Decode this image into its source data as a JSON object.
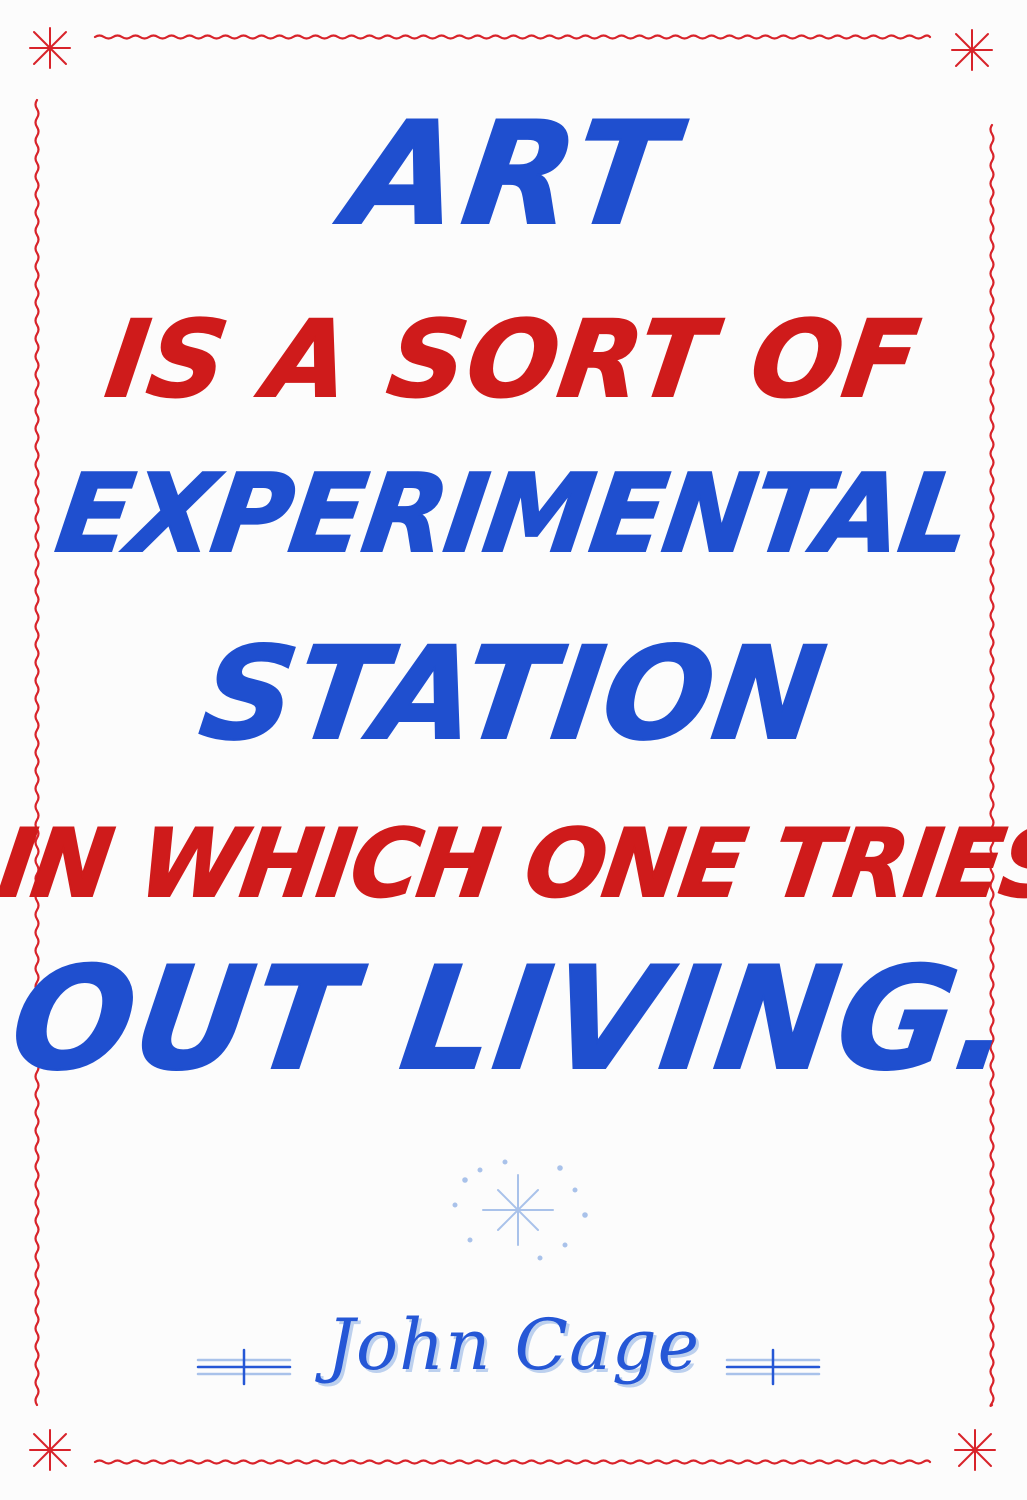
{
  "poster": {
    "lines": [
      {
        "text": "ART",
        "color": "#1f4fcf"
      },
      {
        "text": "IS A SORT OF",
        "color": "#cf1b1b"
      },
      {
        "text": "EXPERIMENTAL",
        "color": "#1f4fcf"
      },
      {
        "text": "STATION",
        "color": "#1f4fcf"
      },
      {
        "text": "IN WHICH ONE TRIES",
        "color": "#cf1b1b"
      },
      {
        "text": "OUT LIVING.",
        "color": "#1f4fcf"
      }
    ],
    "author": "John Cage"
  },
  "colors": {
    "blue": "#1f4fcf",
    "red": "#cf1b1b",
    "light_blue": "#bcd0ee",
    "paper": "#fcfcfc"
  },
  "decorations": {
    "border": "red-wavy-border",
    "corners": "red-sparkle-icon",
    "center_ornament": "light-blue-sparkle-icon",
    "signature_flanks": "blue-cross-flourish-icon"
  }
}
